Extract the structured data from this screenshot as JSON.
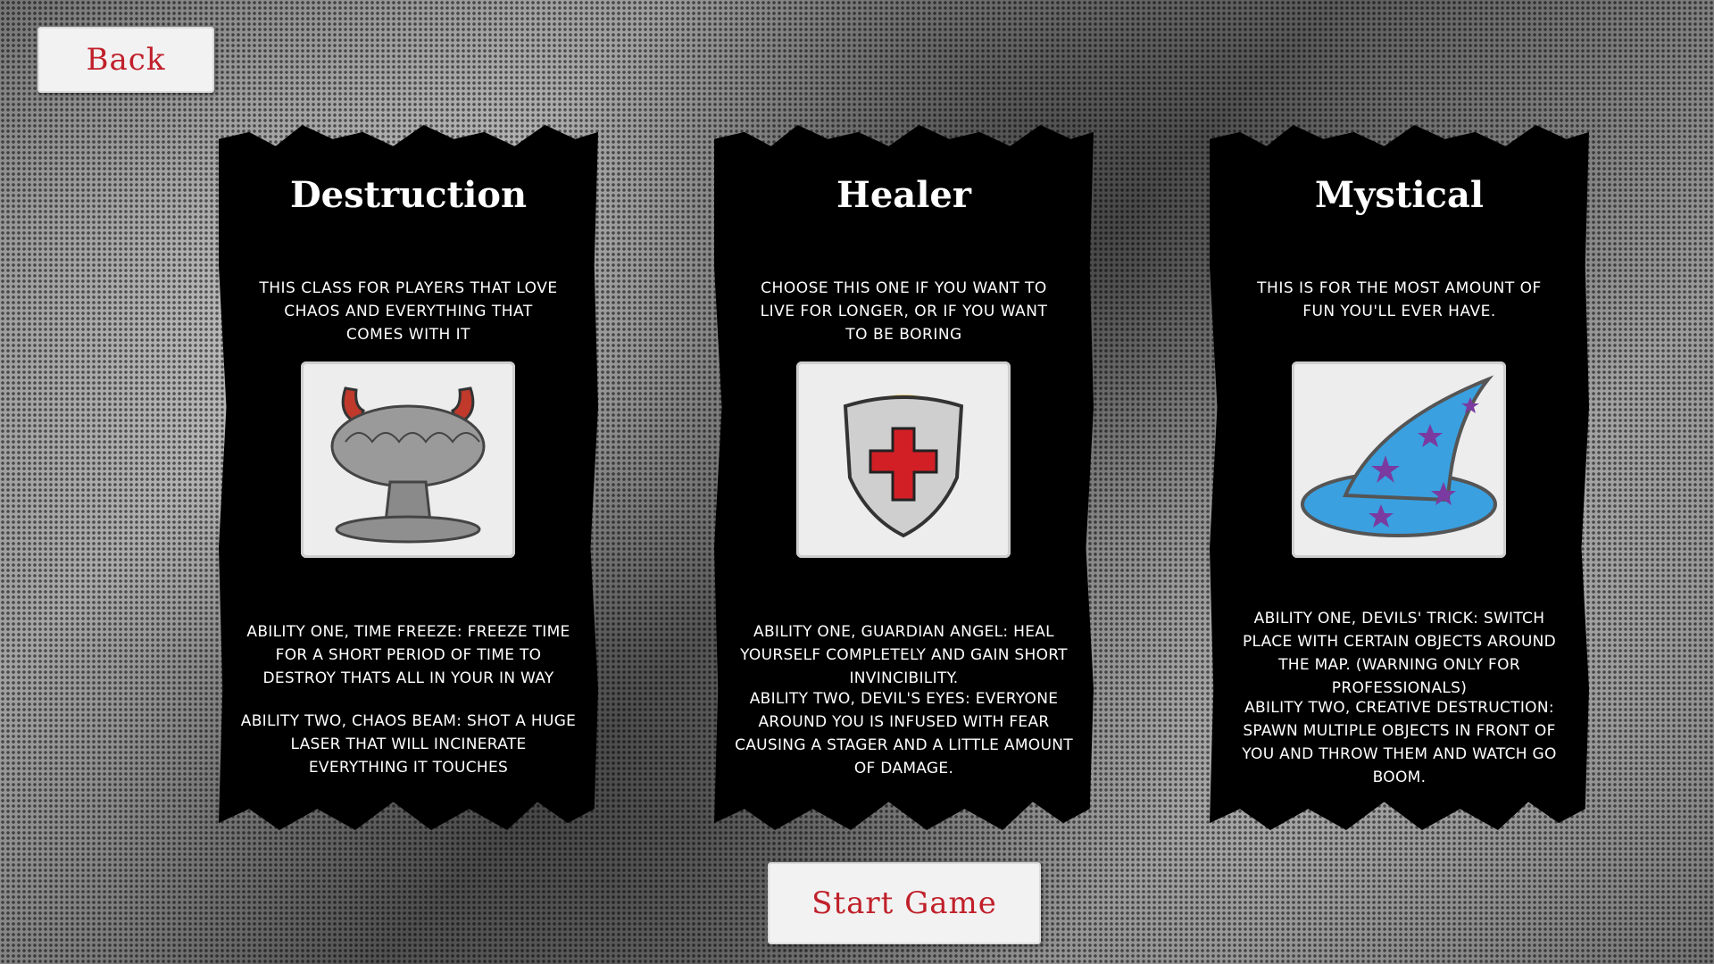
{
  "buttons": {
    "back": "Back",
    "start": "Start Game"
  },
  "classes": [
    {
      "title": "Destruction",
      "description": "This class for players that love chaos and everything that comes with it",
      "icon": "mushroom-cloud-with-horns-icon",
      "ability_one": "Ability one, Time Freeze: freeze time for a short period of time to destroy thats all in your in way",
      "ability_two": "Ability two, chaos beam: shot a huge laser that will incinerate everything it touches"
    },
    {
      "title": "Healer",
      "description": "Choose this one if you want to live for longer, or if you want to be boring",
      "icon": "shield-with-red-cross-and-halo-icon",
      "ability_one": "Ability one, Guardian Angel: heal yourself completely and gain short invincibility.",
      "ability_two": "Ability two, Devil's eyes: Everyone around you is infused with fear causing a stager and a little amount of damage."
    },
    {
      "title": "Mystical",
      "description": "This is for the most amount of fun you'll ever have.",
      "icon": "wizard-hat-with-stars-icon",
      "ability_one": "Ability one, Devils' Trick: Switch place with certain objects around the map. (Warning only for professionals)",
      "ability_two": "Ability two, creative destruction: spawn multiple objects in front of you and throw them and watch go boom."
    }
  ],
  "colors": {
    "button_text": "#c0202a",
    "card_bg": "#000000"
  }
}
